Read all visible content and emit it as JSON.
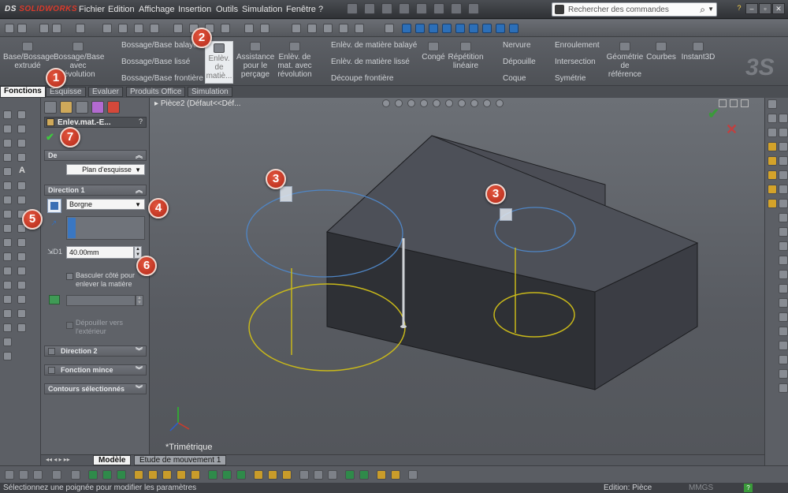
{
  "app": {
    "logo_text": "SOLIDWORKS",
    "logo_prefix": "DS"
  },
  "menus": [
    "Fichier",
    "Edition",
    "Affichage",
    "Insertion",
    "Outils",
    "Simulation",
    "Fenêtre",
    "?"
  ],
  "search": {
    "placeholder": "Rechercher des commandes"
  },
  "ribbon": {
    "extrude": "Base/Bossage extrudé",
    "revolve": "Bossage/Base avec révolution",
    "swept": "Bossage/Base balayé",
    "loft": "Bossage/Base lissé",
    "boundary": "Bossage/Base frontière",
    "cut_extrude": "Enlèv. de matiè...",
    "hole_wizard": "Assistance pour le perçage",
    "cut_revolve": "Enlèv. de mat. avec révolution",
    "cut_swept": "Enlèv. de matière balayé",
    "cut_loft": "Enlèv. de matière lissé",
    "cut_boundary": "Découpe frontière",
    "fillet": "Congé",
    "linear_pattern": "Répétition linéaire",
    "rib": "Nervure",
    "draft": "Dépouille",
    "shell": "Coque",
    "wrap": "Enroulement",
    "intersect": "Intersection",
    "mirror": "Symétrie",
    "ref_geometry": "Géométrie de référence",
    "curves": "Courbes",
    "instant3d": "Instant3D"
  },
  "tabs": [
    "Fonctions",
    "Esquisse",
    "Evaluer",
    "Produits Office",
    "Simulation"
  ],
  "property_manager": {
    "title": "Enlev.mat.-E...",
    "from_label": "De",
    "from_value": "Plan d'esquisse",
    "direction1_label": "Direction 1",
    "end_condition": "Borgne",
    "depth": "40.00mm",
    "flip_side_label": "Basculer côté pour enlever la matière",
    "draft_outward_label": "Dépouiller vers l'extérieur",
    "direction2_label": "Direction 2",
    "thin_feature_label": "Fonction mince",
    "selected_contours_label": "Contours sélectionnés"
  },
  "viewport": {
    "part_title": "Pièce2  (Défaut<<Déf...",
    "view_name": "*Trimétrique"
  },
  "bottom_tabs": [
    "Modèle",
    "Etude de mouvement 1"
  ],
  "status": {
    "message": "Sélectionnez une poignée pour modifier les paramètres",
    "mode": "Edition: Pièce",
    "units": "MMGS"
  },
  "badges": [
    "1",
    "2",
    "3",
    "3",
    "4",
    "5",
    "6",
    "7"
  ],
  "colors": {
    "sketch_blue": "#4f86c6",
    "sketch_yellow": "#c8b81a",
    "badge_red": "#c93a24",
    "accept_green": "#3a9a3a",
    "cancel_red": "#c04040"
  }
}
